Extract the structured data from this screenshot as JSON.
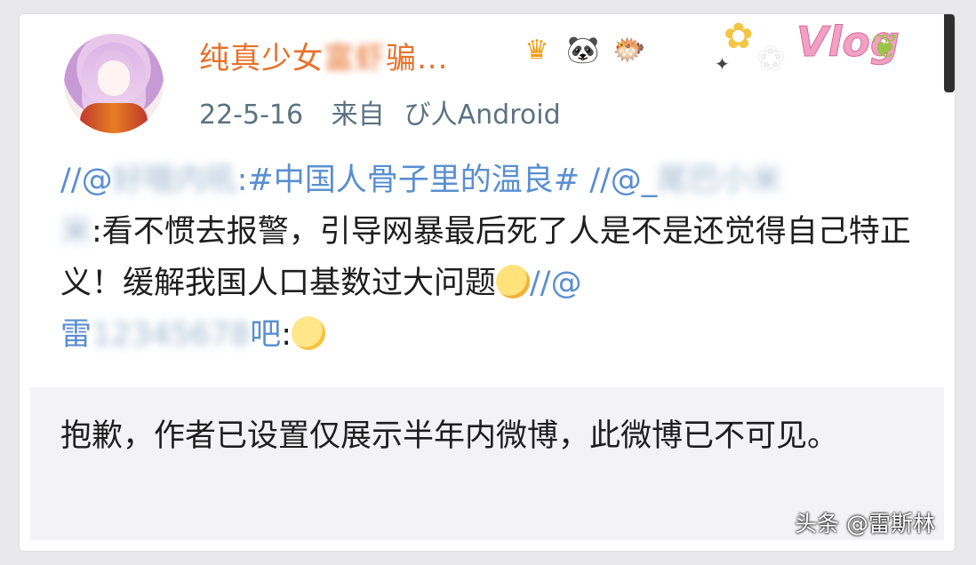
{
  "post": {
    "username_visible": "纯真少女",
    "username_blurred": "富虾",
    "username_tail": "骗...",
    "date": "22-5-16",
    "source_prefix": "来自",
    "source_device": "び人Android",
    "mention1_prefix": "//@",
    "mention1_blurred": "好哦内吼",
    "hashtag": ":#中国人骨子里的温良#",
    "mention2_prefix": "//@_",
    "mention2_blurred": "尾巴小米",
    "line2_blurred": "米",
    "body_text": ":看不惯去报警，引导网暴最后死了人是不是还觉得自己特正义！缓解我国人口基数过大问题",
    "mention3_prefix": "//@",
    "mention3_first": "雷",
    "mention3_blurred": "12345678",
    "mention3_last": "吧",
    "colon": ":"
  },
  "notice": {
    "text": "抱歉，作者已设置仅展示半年内微博，此微博已不可见。"
  },
  "decoration": {
    "vlog_logo": "Vlog"
  },
  "watermark": "头条 @雷斯林",
  "colors": {
    "username": "#e8702a",
    "mention": "#5a8fd1",
    "meta": "#5b7281",
    "notice_bg": "#f3f3f5"
  },
  "icons": [
    "crown-icon",
    "panda-icon",
    "fish-icon"
  ]
}
